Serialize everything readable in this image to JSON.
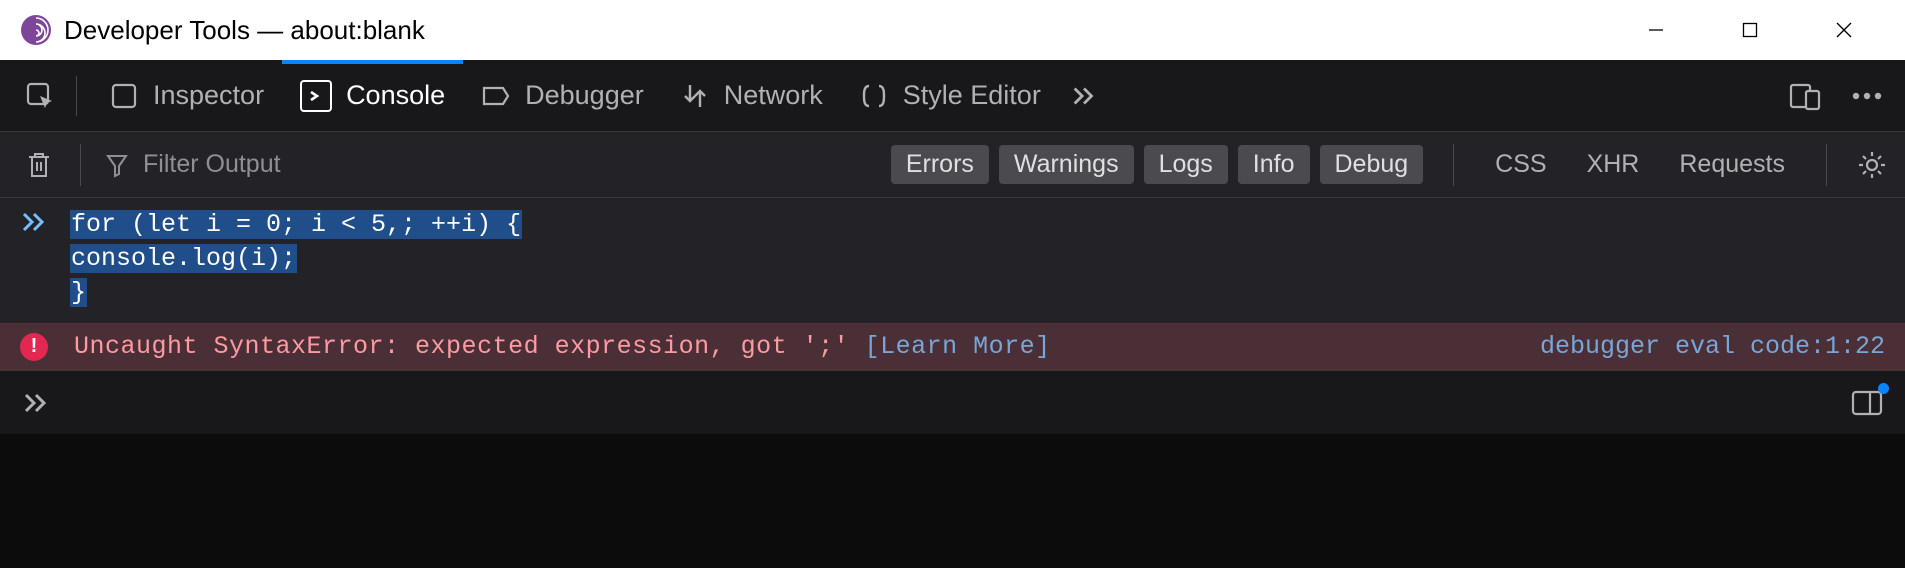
{
  "window": {
    "title": "Developer Tools — about:blank"
  },
  "tabs": {
    "inspector": "Inspector",
    "console": "Console",
    "debugger": "Debugger",
    "network": "Network",
    "style_editor": "Style Editor"
  },
  "toolbar": {
    "filter_placeholder": "Filter Output",
    "errors": "Errors",
    "warnings": "Warnings",
    "logs": "Logs",
    "info": "Info",
    "debug": "Debug",
    "css": "CSS",
    "xhr": "XHR",
    "requests": "Requests"
  },
  "console": {
    "input_line1": "for (let i = 0; i < 5,; ++i) {",
    "input_line2": "  console.log(i);",
    "input_line3": "}",
    "error_message": "Uncaught SyntaxError: expected expression, got ';' ",
    "learn_more": "[Learn More]",
    "error_source": "debugger eval code:1:22"
  }
}
